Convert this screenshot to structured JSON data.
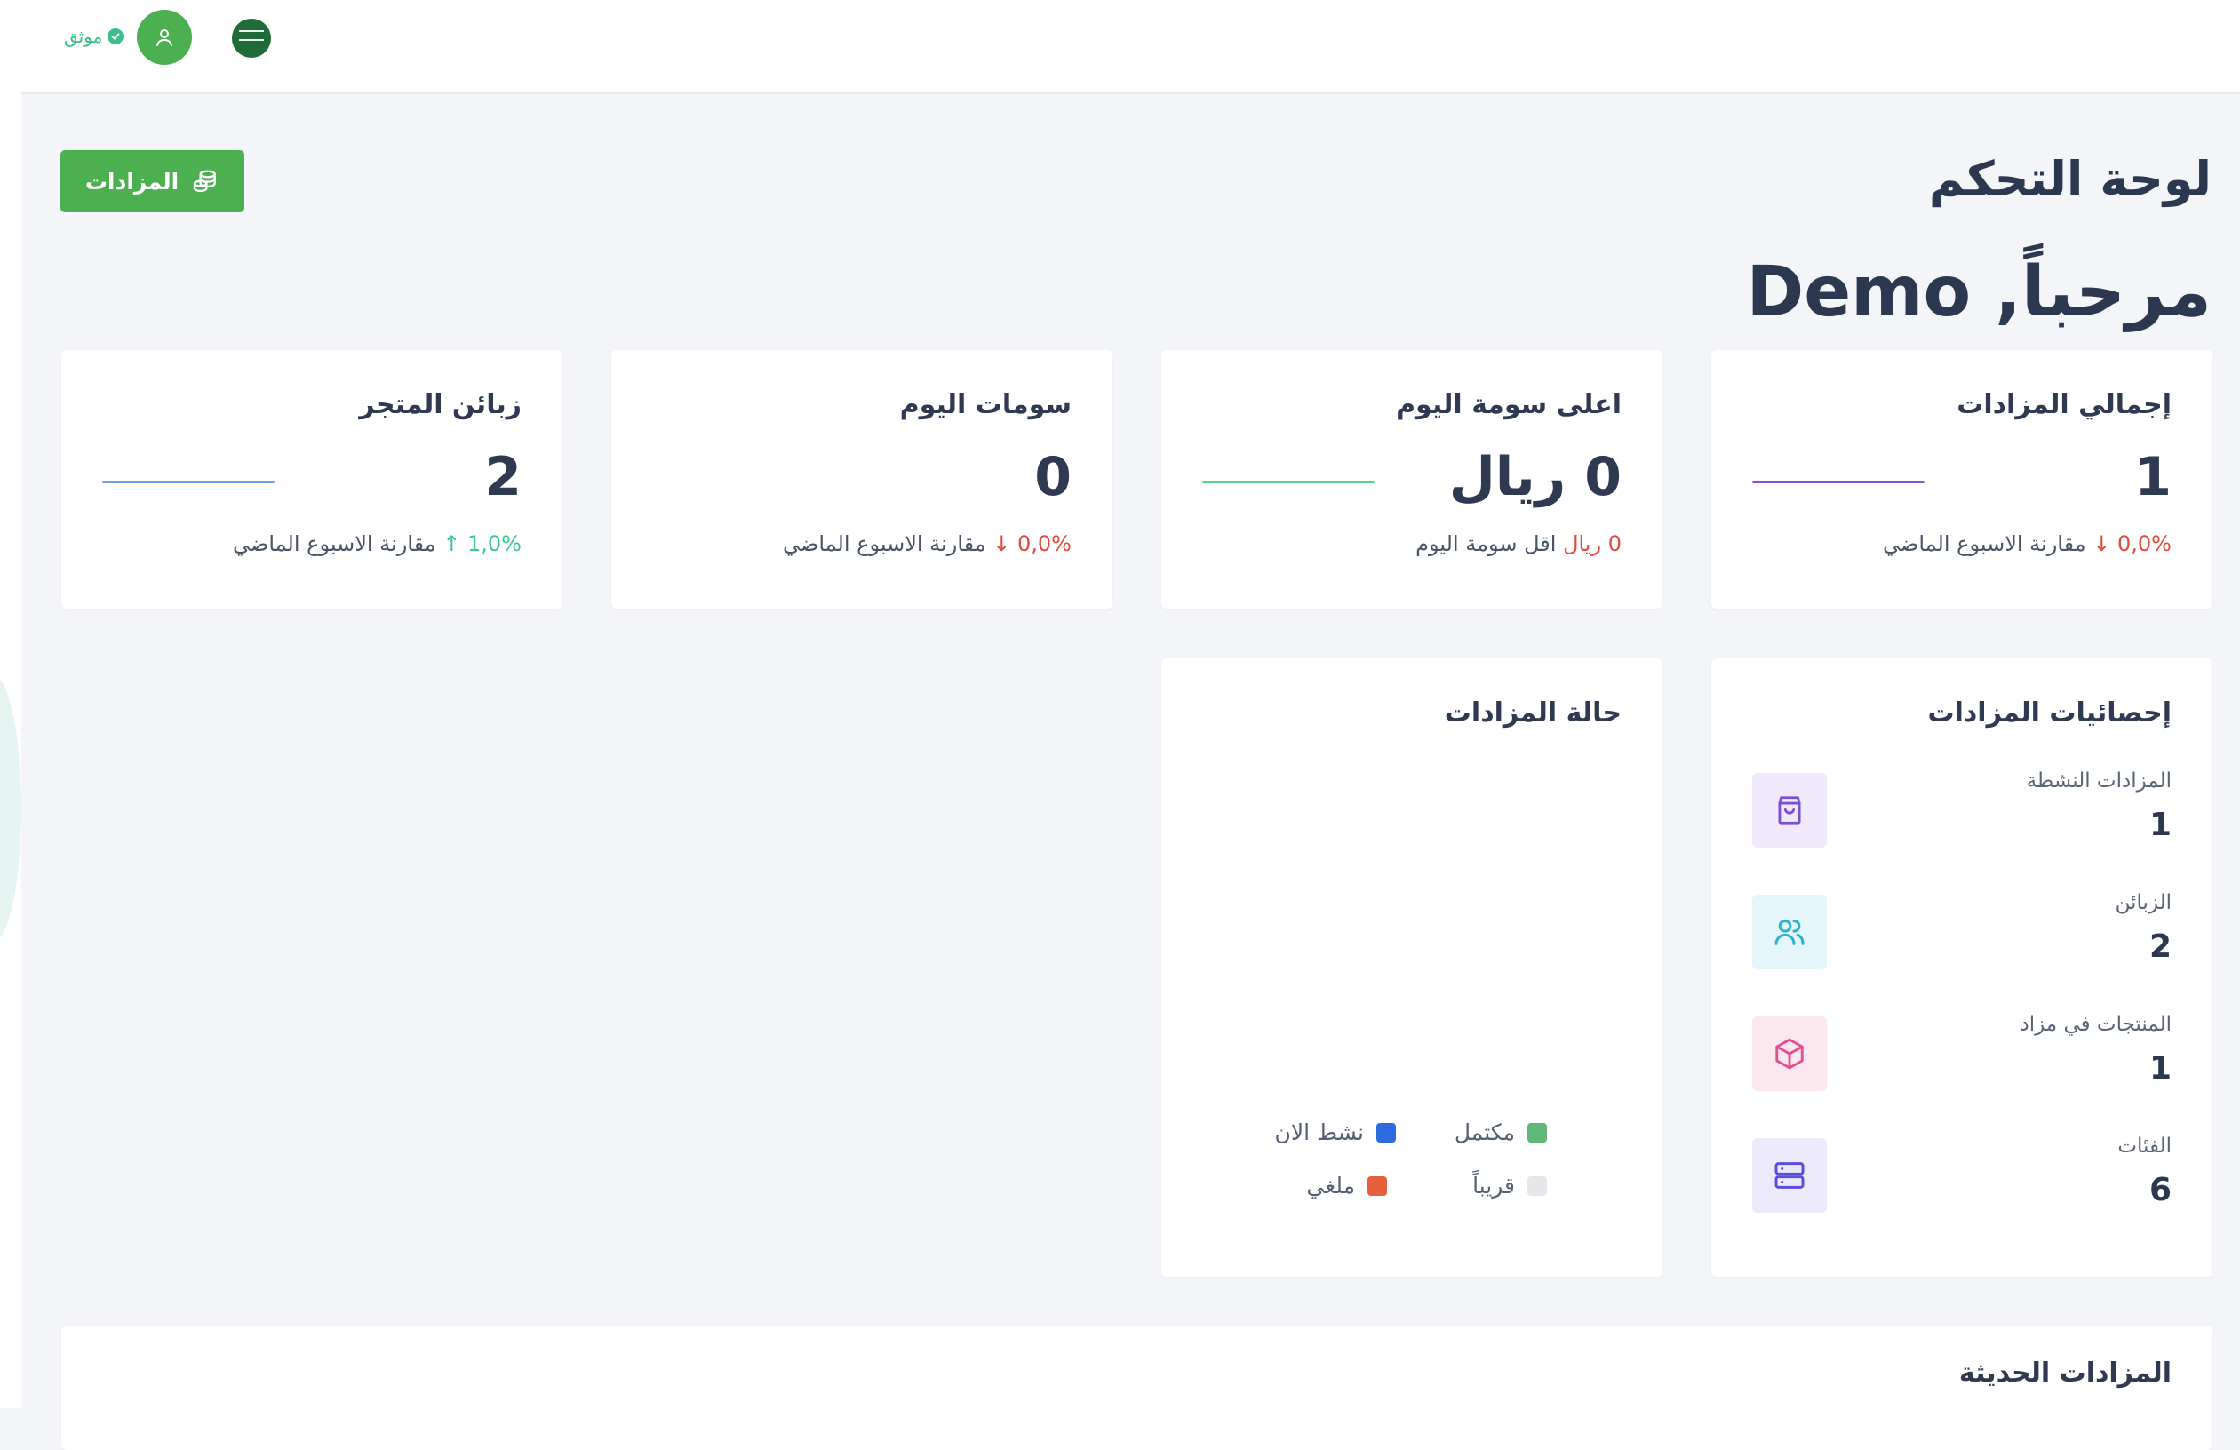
{
  "header": {
    "verified_label": "موثق"
  },
  "toolbar": {
    "auctions_button_label": "المزادات"
  },
  "page": {
    "title": "لوحة التحكم",
    "welcome": "مرحباً, Demo"
  },
  "stats": [
    {
      "title": "إجمالي المزادات",
      "value": "1",
      "change": "0,0%",
      "change_arrow": "↓",
      "change_text": "مقارنة الاسبوع الماضي",
      "change_color": "#e04b3a",
      "line_color": "#8b4fd8"
    },
    {
      "title": "اعلى سومة اليوم",
      "value": "0 ريال",
      "change": "0 ريال",
      "change_arrow": "",
      "change_text": "اقل سومة اليوم",
      "change_color": "#e04b3a",
      "line_color": "#56d48f"
    },
    {
      "title": "سومات اليوم",
      "value": "0",
      "change": "0,0%",
      "change_arrow": "↓",
      "change_text": "مقارنة الاسبوع الماضي",
      "change_color": "#e04b3a",
      "line_color": "#ffffff"
    },
    {
      "title": "زبائن المتجر",
      "value": "2",
      "change": "1,0%",
      "change_arrow": "↑",
      "change_text": "مقارنة الاسبوع الماضي",
      "change_color": "#3cc78f",
      "line_color": "#6aa0e8"
    }
  ],
  "auction_stats": {
    "title": "إحصائيات المزادات",
    "items": [
      {
        "label": "المزادات النشطة",
        "value": "1",
        "icon": "shopping-bag-icon",
        "bg": "#efe9fb",
        "color": "#7a4fd8"
      },
      {
        "label": "الزبائن",
        "value": "2",
        "icon": "users-icon",
        "bg": "#e4f6fa",
        "color": "#2bb3cf"
      },
      {
        "label": "المنتجات في مزاد",
        "value": "1",
        "icon": "box-icon",
        "bg": "#fde7ef",
        "color": "#e2508f"
      },
      {
        "label": "الفئات",
        "value": "6",
        "icon": "server-icon",
        "bg": "#ece9fb",
        "color": "#5b4fd8"
      }
    ]
  },
  "auction_status": {
    "title": "حالة المزادات",
    "legend": [
      {
        "label": "مكتمل",
        "color": "#5fb878"
      },
      {
        "label": "نشط الان",
        "color": "#2f6be0"
      },
      {
        "label": "قريباً",
        "color": "#e6e7ea"
      },
      {
        "label": "ملغي",
        "color": "#e5603d"
      }
    ]
  },
  "recent": {
    "title": "المزادات الحديثة"
  }
}
